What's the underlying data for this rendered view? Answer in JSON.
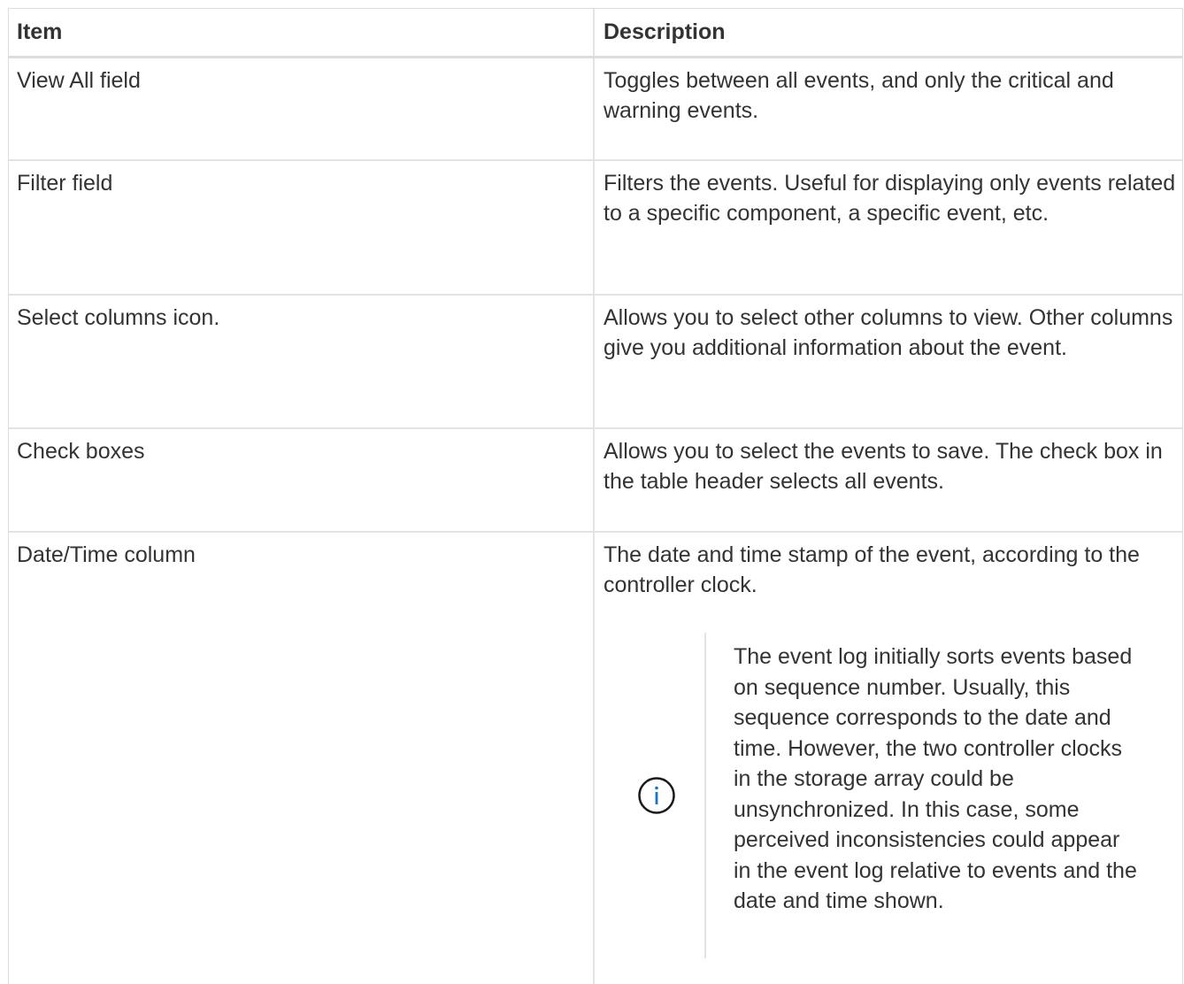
{
  "table": {
    "headers": {
      "item": "Item",
      "description": "Description"
    },
    "rows": [
      {
        "item": "View All field",
        "description": "Toggles between all events, and only the critical and warning events."
      },
      {
        "item": "Filter field",
        "description": "Filters the events. Useful for displaying only events related to a specific component, a specific event, etc."
      },
      {
        "item": "Select columns icon.",
        "description": "Allows you to select other columns to view. Other columns give you additional information about the event."
      },
      {
        "item": "Check boxes",
        "description": "Allows you to select the events to save. The check box in the table header selects all events."
      },
      {
        "item": "Date/Time column",
        "description": "The date and time stamp of the event, according to the controller clock."
      }
    ],
    "note": {
      "icon": "info-icon",
      "text": "The event log initially sorts events based on sequence number. Usually, this sequence corresponds to the date and time. However, the two controller clocks in the storage array could be unsynchronized. In this case, some perceived inconsistencies could appear in the event log relative to events and the date and time shown."
    }
  },
  "colors": {
    "text": "#333333",
    "border": "#dddddd",
    "info_icon": "#1a73c8"
  }
}
